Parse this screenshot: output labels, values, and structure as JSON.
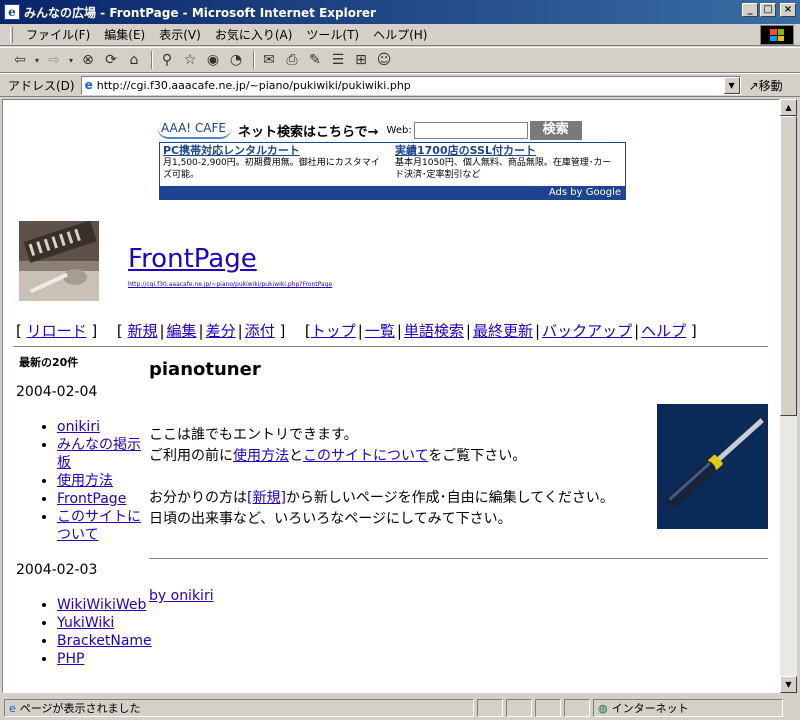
{
  "window": {
    "title": "みんなの広場 - FrontPage - Microsoft Internet Explorer"
  },
  "menu": [
    "ファイル(F)",
    "編集(E)",
    "表示(V)",
    "お気に入り(A)",
    "ツール(T)",
    "ヘルプ(H)"
  ],
  "toolbar": {
    "icons": [
      "back-icon",
      "forward-icon",
      "stop-icon",
      "refresh-icon",
      "home-icon",
      "search-icon",
      "favorites-icon",
      "media-icon",
      "history-icon",
      "mail-icon",
      "print-icon",
      "edit-icon",
      "discuss-icon",
      "messenger-icon"
    ]
  },
  "address": {
    "label": "アドレス(D)",
    "url": "http://cgi.f30.aaacafe.ne.jp/~piano/pukiwiki/pukiwiki.php",
    "go_label": "移動"
  },
  "ad": {
    "logo": "AAA! CAFE",
    "slogan": "ネット検索はこちらで→",
    "web_label": "Web:",
    "search_button": "検索",
    "unit1_head": "PC携帯対応レンタルカート",
    "unit1_body": "月1,500-2,900円。初期費用無。御社用にカスタマイズ可能。",
    "unit2_head": "実績1700店のSSL付カート",
    "unit2_body": "基本月1050円、個人無料、商品無限。在庫管理･カード決済･定率割引など",
    "footer": "Ads by Google"
  },
  "page": {
    "title": "FrontPage",
    "url": "http://cgi.f30.aaacafe.ne.jp/~piano/pukiwiki/pukiwiki.php?FrontPage"
  },
  "nav": {
    "reload": "リロード",
    "edit_group": [
      "新規",
      "編集",
      "差分",
      "添付"
    ],
    "main_group": [
      "トップ",
      "一覧",
      "単語検索",
      "最終更新",
      "バックアップ",
      "ヘルプ"
    ]
  },
  "sidebar": {
    "heading": "最新の20件",
    "groups": [
      {
        "date": "2004-02-04",
        "items": [
          "onikiri",
          "みんなの掲示板",
          "使用方法",
          "FrontPage",
          "このサイトについて"
        ]
      },
      {
        "date": "2004-02-03",
        "items": [
          "WikiWikiWeb",
          "YukiWiki",
          "BracketName",
          "PHP"
        ]
      }
    ]
  },
  "content": {
    "heading": "pianotuner",
    "line1": "ここは誰でもエントリできます。",
    "line2_pre": "ご利用の前に",
    "line2_link1": "使用方法",
    "line2_mid": "と",
    "line2_link2": "このサイトについて",
    "line2_post": "をご覧下さい。",
    "line3_pre": "お分かりの方は",
    "line3_link": "[新規]",
    "line3_post": "から新しいページを作成･自由に編集してください。",
    "line4": "日頃の出来事など、いろいろなページにしてみて下さい。",
    "author": "by onikiri"
  },
  "status": {
    "text": "ページが表示されました",
    "zone": "インターネット"
  }
}
